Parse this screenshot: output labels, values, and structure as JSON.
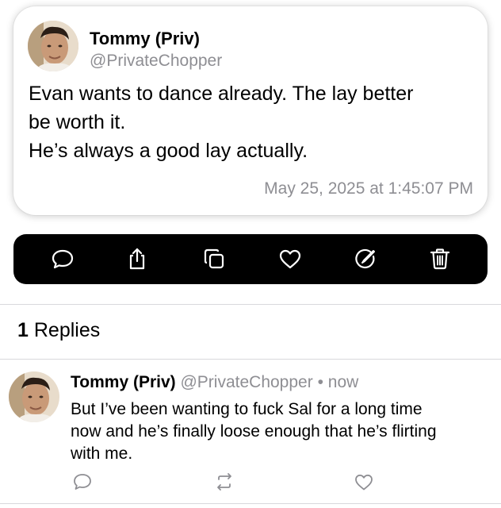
{
  "post": {
    "author_name": "Tommy (Priv)",
    "author_handle": "@PrivateChopper",
    "body_lines": [
      "Evan wants to dance already. The lay better",
      "be worth it.",
      "He’s always a good lay actually."
    ],
    "timestamp": "May 25, 2025 at 1:45:07 PM"
  },
  "action_bar": {
    "icons": [
      "comment-icon",
      "share-icon",
      "copy-icon",
      "heart-icon",
      "edit-icon",
      "trash-icon"
    ]
  },
  "replies": {
    "count": "1",
    "label": "Replies"
  },
  "reply": {
    "author_name": "Tommy (Priv)",
    "author_handle": "@PrivateChopper",
    "separator": "•",
    "time": "now",
    "body_lines": [
      "But I’ve been wanting to fuck Sal for a long time",
      "now and he’s finally loose enough that he’s flirting",
      "with me."
    ],
    "icons": [
      "comment-icon",
      "repost-icon",
      "heart-icon"
    ]
  },
  "colors": {
    "secondary_text": "#8e8e93",
    "action_bar_bg": "#000000",
    "divider": "#d8d8dc"
  }
}
